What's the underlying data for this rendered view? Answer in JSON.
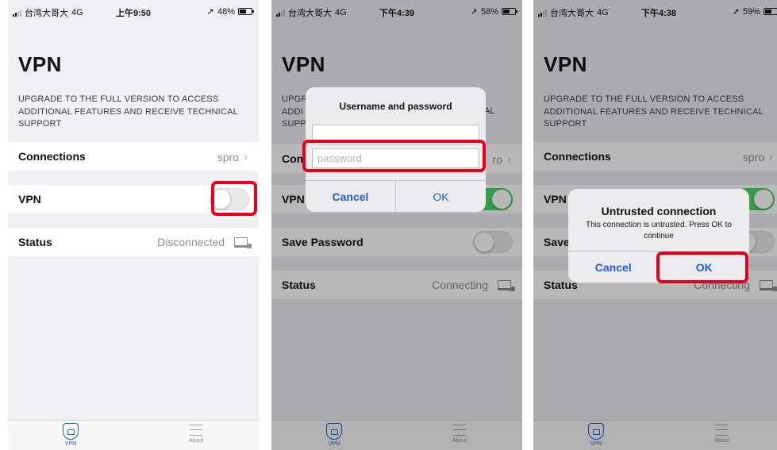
{
  "colors": {
    "accent": "#1f5ad8",
    "toggle_on": "#4cd964",
    "highlight": "#e8001a"
  },
  "screens": [
    {
      "status": {
        "carrier": "台湾大哥大",
        "network": "4G",
        "time": "上午9:50",
        "battery": "48%"
      },
      "title": "VPN",
      "upgrade": "UPGRADE TO THE FULL VERSION TO ACCESS ADDITIONAL FEATURES AND RECEIVE TECHNICAL SUPPORT",
      "rows": {
        "connections": {
          "label": "Connections",
          "value": "spro"
        },
        "vpn": {
          "label": "VPN",
          "on": false
        },
        "status": {
          "label": "Status",
          "value": "Disconnected"
        }
      },
      "tabs": [
        "VPN",
        "About"
      ]
    },
    {
      "status": {
        "carrier": "台湾大哥大",
        "network": "4G",
        "time": "下午4:39",
        "battery": "58%"
      },
      "title": "VPN",
      "rows": {
        "connections": {
          "label": "Con",
          "value": "ro"
        },
        "vpn": {
          "label": "VPN",
          "on": true
        },
        "save_password": {
          "label": "Save Password",
          "on": false
        },
        "status": {
          "label": "Status",
          "value": "Connecting"
        }
      },
      "dialog": {
        "title": "Username and password",
        "username": "",
        "password_placeholder": "password",
        "cancel": "Cancel",
        "ok": "OK",
        "behind_text": [
          "UPGR",
          "ADDI",
          "SUPP",
          "AL"
        ]
      },
      "tabs": [
        "VPN",
        "About"
      ]
    },
    {
      "status": {
        "carrier": "台湾大哥大",
        "network": "4G",
        "time": "下午4:38",
        "battery": "59%"
      },
      "title": "VPN",
      "upgrade": "UPGRADE TO THE FULL VERSION TO ACCESS ADDITIONAL FEATURES AND RECEIVE TECHNICAL SUPPORT",
      "rows": {
        "connections": {
          "label": "Connections",
          "value": "spro"
        },
        "vpn": {
          "label": "VPN",
          "on": true
        },
        "save_password": {
          "label": "Save",
          "on": false
        },
        "status": {
          "label": "Status",
          "value": "Connecting"
        }
      },
      "dialog": {
        "title": "Untrusted connection",
        "message": "This connection is untrusted. Press OK to continue",
        "cancel": "Cancel",
        "ok": "OK"
      },
      "tabs": [
        "VPN",
        "About"
      ]
    }
  ]
}
